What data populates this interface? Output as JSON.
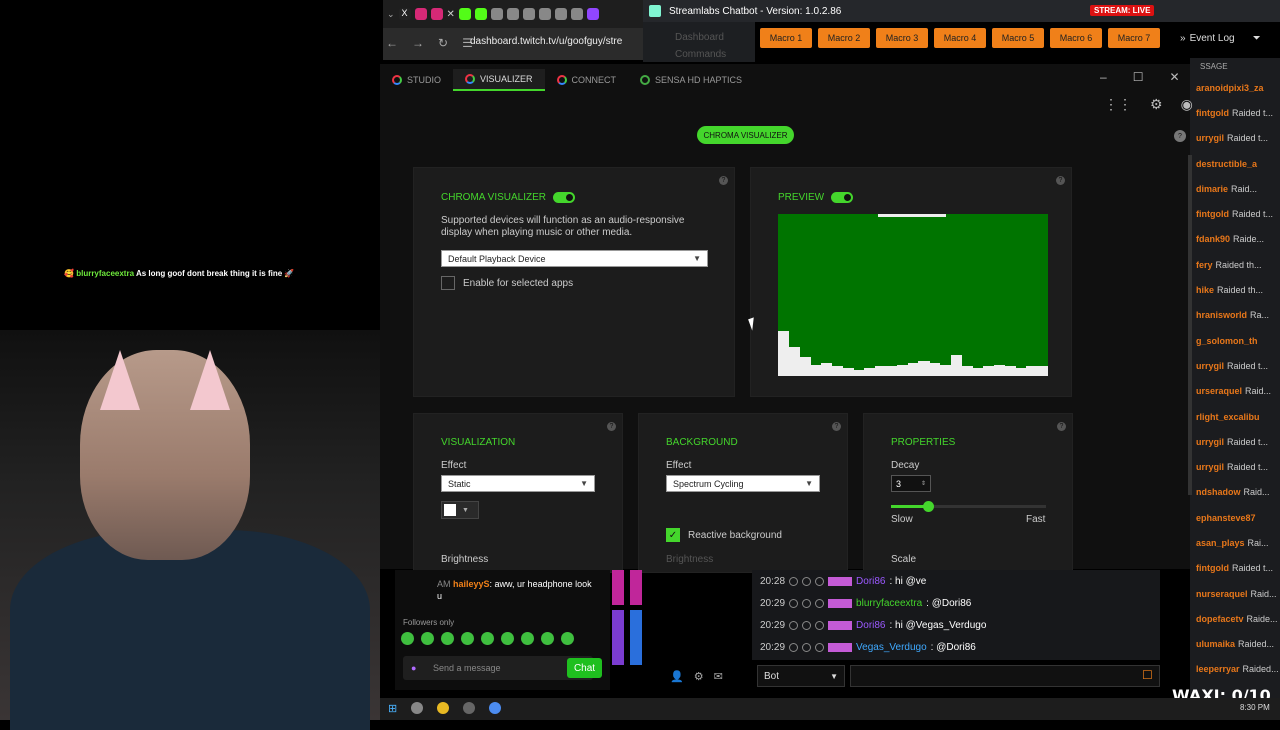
{
  "webcam": {
    "overlay_chat": {
      "emotes": "🥰",
      "user": "blurryfaceextra",
      "message": "As long goof dont break thing it is fine 🚀"
    }
  },
  "browser": {
    "url": "dashboard.twitch.tv/u/goofguy/stre",
    "tab_close": "✕"
  },
  "streamlabs": {
    "title": "Streamlabs Chatbot - Version: 1.0.2.86",
    "stream_status": "STREAM: LIVE",
    "menu": [
      "Dashboard",
      "Commands"
    ],
    "macros": [
      "Macro 1",
      "Macro 2",
      "Macro 3",
      "Macro 4",
      "Macro 5",
      "Macro 6",
      "Macro 7"
    ],
    "event_log_label": "Event Log",
    "event_header": "SSAGE",
    "events": [
      {
        "name": "aranoidpixi3_za",
        "text": ""
      },
      {
        "name": "fintgold",
        "text": "Raided t..."
      },
      {
        "name": "urrygil",
        "text": "Raided t..."
      },
      {
        "name": "destructible_a",
        "text": ""
      },
      {
        "name": "dimarie",
        "text": "Raid..."
      },
      {
        "name": "fintgold",
        "text": "Raided t..."
      },
      {
        "name": "fdank90",
        "text": "Raide..."
      },
      {
        "name": "fery",
        "text": "Raided th..."
      },
      {
        "name": "hike",
        "text": "Raided th..."
      },
      {
        "name": "hranisworld",
        "text": "Ra..."
      },
      {
        "name": "g_solomon_th",
        "text": ""
      },
      {
        "name": "urrygil",
        "text": "Raided t..."
      },
      {
        "name": "urseraquel",
        "text": "Raid..."
      },
      {
        "name": "rlight_excalibu",
        "text": ""
      },
      {
        "name": "urrygil",
        "text": "Raided t..."
      },
      {
        "name": "urrygil",
        "text": "Raided t..."
      },
      {
        "name": "ndshadow",
        "text": "Raid..."
      },
      {
        "name": "ephansteve87",
        "text": ""
      },
      {
        "name": "asan_plays",
        "text": "Rai..."
      },
      {
        "name": "fintgold",
        "text": "Raided t..."
      },
      {
        "name": "nurseraquel",
        "text": "Raid..."
      },
      {
        "name": "dopefacetv",
        "text": "Raide..."
      },
      {
        "name": "ulumaika",
        "text": "Raided..."
      },
      {
        "name": "leeperryar",
        "text": "Raided..."
      }
    ],
    "chat": [
      {
        "time": "20:28",
        "user": "Dori86",
        "user_color": "#9b59ff",
        "message": ": hi @ve"
      },
      {
        "time": "20:29",
        "user": "blurryfaceextra",
        "user_color": "#44d62c",
        "message": ": @Dori86"
      },
      {
        "time": "20:29",
        "user": "Dori86",
        "user_color": "#9b59ff",
        "message": ": hi @Vegas_Verdugo"
      },
      {
        "time": "20:29",
        "user": "Vegas_Verdugo",
        "user_color": "#3fa9ff",
        "message": ": @Dori86"
      }
    ],
    "bot_select": "Bot"
  },
  "razer": {
    "tabs": [
      {
        "label": "STUDIO",
        "active": false
      },
      {
        "label": "VISUALIZER",
        "active": true
      },
      {
        "label": "CONNECT",
        "active": false
      },
      {
        "label": "SENSA HD HAPTICS",
        "active": false
      }
    ],
    "pill": "CHROMA VISUALIZER",
    "chroma": {
      "heading": "CHROMA VISUALIZER",
      "description": "Supported devices will function as an audio-responsive display when playing music or other media.",
      "device": "Default Playback Device",
      "enable_label": "Enable for selected apps",
      "enabled": true
    },
    "preview": {
      "heading": "PREVIEW",
      "enabled": true,
      "bars": [
        0.28,
        0.18,
        0.12,
        0.07,
        0.08,
        0.06,
        0.05,
        0.04,
        0.05,
        0.06,
        0.06,
        0.07,
        0.08,
        0.09,
        0.08,
        0.07,
        0.13,
        0.06,
        0.05,
        0.06,
        0.07,
        0.06,
        0.05,
        0.06,
        0.06
      ]
    },
    "visualization": {
      "heading": "VISUALIZATION",
      "effect_label": "Effect",
      "effect": "Static",
      "brightness_label": "Brightness"
    },
    "background": {
      "heading": "BACKGROUND",
      "effect_label": "Effect",
      "effect": "Spectrum Cycling",
      "reactive_label": "Reactive background",
      "reactive": true,
      "brightness_label": "Brightness"
    },
    "properties": {
      "heading": "PROPERTIES",
      "decay_label": "Decay",
      "decay_value": "3",
      "slow_label": "Slow",
      "fast_label": "Fast",
      "scale_label": "Scale",
      "slider_level": 0.24
    }
  },
  "twitch_chat": {
    "time_fragment": "AM",
    "user": "haileyyS",
    "message": ": aww, ur headphone look u",
    "followers_only": "Followers only",
    "send_placeholder": "Send a message",
    "chat_button": "Chat"
  },
  "overlay": {
    "waxi": "WAXI: 0/10"
  },
  "taskbar": {
    "time": "8:30 PM"
  },
  "colors": {
    "razer_green": "#44d62c",
    "preview_bg": "#007400",
    "macro": "#f08019"
  }
}
